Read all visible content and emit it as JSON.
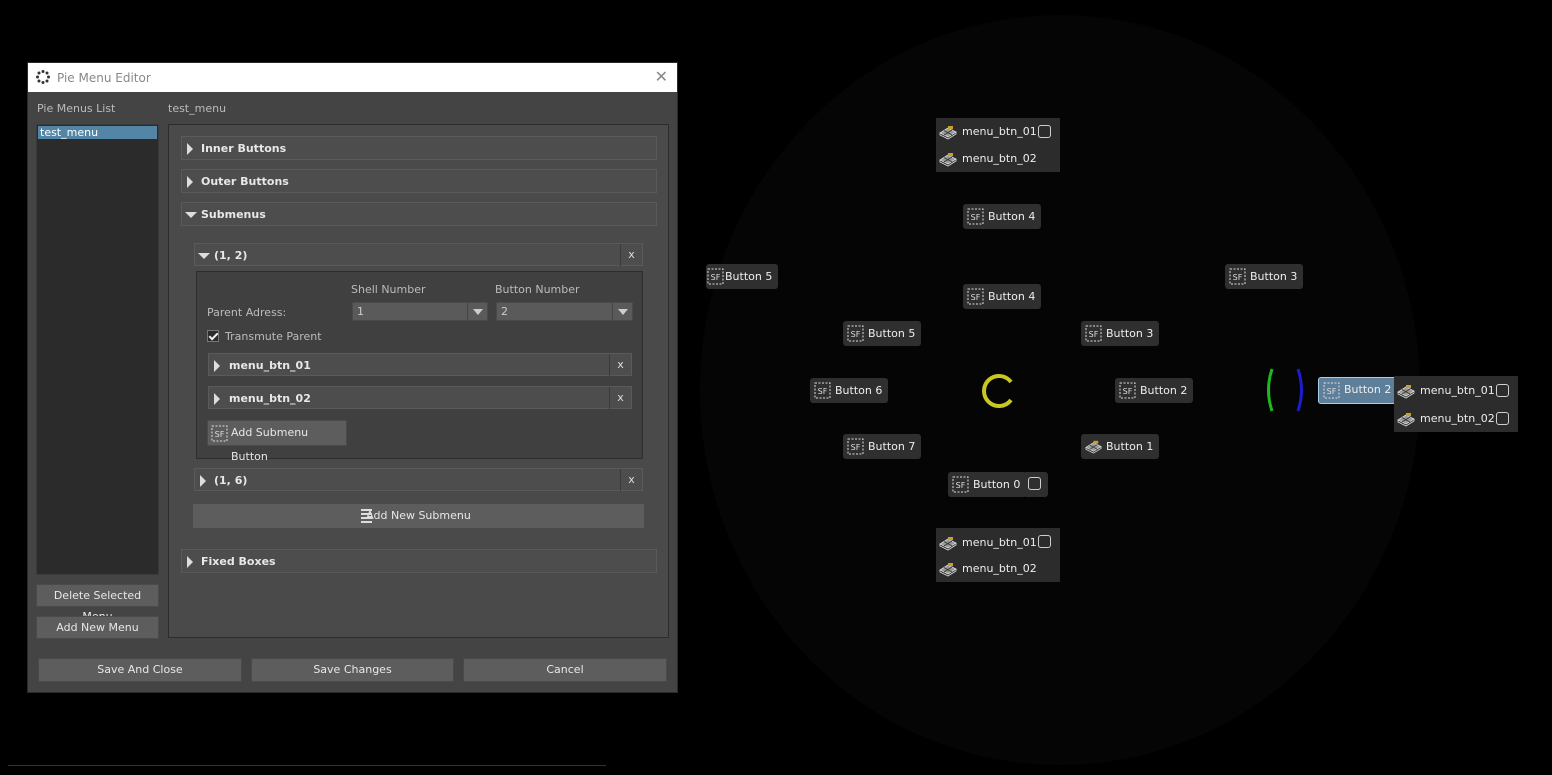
{
  "editor": {
    "title": "Pie Menu Editor",
    "close_glyph": "✕",
    "list_header": "Pie Menus List",
    "menus": [
      "test_menu"
    ],
    "current_menu": "test_menu",
    "delete_label": "Delete Selected Menu",
    "add_menu_label": "Add New Menu",
    "sections": {
      "inner": "Inner Buttons",
      "outer": "Outer Buttons",
      "submenus": "Submenus",
      "fixed": "Fixed Boxes"
    },
    "submenu_a": {
      "name": "(1, 2)",
      "remove": "x",
      "shell_header": "Shell Number",
      "button_header": "Button Number",
      "parent_label": "Parent Adress:",
      "shell_value": "1",
      "button_value": "2",
      "transmute_label": "Transmute Parent",
      "transmute_checked": true,
      "buttons": [
        "menu_btn_01",
        "menu_btn_02"
      ],
      "add_button_label": "Add Submenu Button"
    },
    "submenu_b": {
      "name": "(1, 6)",
      "remove": "x"
    },
    "add_submenu_label": "Add New Submenu",
    "footer": {
      "save_close": "Save And Close",
      "save": "Save Changes",
      "cancel": "Cancel"
    }
  },
  "preview": {
    "top_group": [
      "menu_btn_01",
      "menu_btn_02"
    ],
    "bottom_group": [
      "menu_btn_01",
      "menu_btn_02"
    ],
    "right_group": [
      "menu_btn_01",
      "menu_btn_02"
    ],
    "outer_top": "Button 4",
    "outer_left": "Button 5",
    "outer_right": "Button 3",
    "inner": {
      "b4": "Button 4",
      "b5": "Button 5",
      "b3": "Button 3",
      "b6": "Button 6",
      "b2": "Button 2",
      "b7": "Button 7",
      "b1": "Button 1",
      "b0": "Button 0"
    },
    "selected": "Button 2",
    "colors": {
      "center_ring": "#c8c820",
      "arc_left": "#1fb81f",
      "arc_right": "#1c1cd0",
      "selected_bg": "#5d7f9a",
      "list_selection": "#5285a6"
    }
  }
}
